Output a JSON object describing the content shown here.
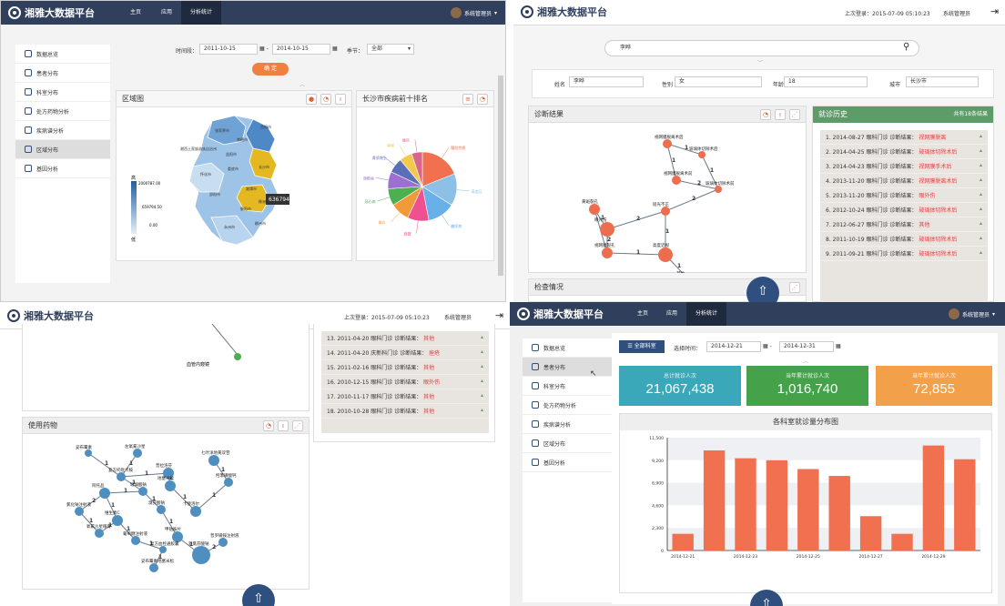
{
  "app": {
    "title": "湘雅大数据平台",
    "admin": "系统管理员",
    "last_login": "上次登录：2015-07-09 05:10:23"
  },
  "nav": {
    "home": "主页",
    "apps": "应用",
    "analytics": "分析统计"
  },
  "sidebar": [
    {
      "label": "数据总览"
    },
    {
      "label": "患者分布"
    },
    {
      "label": "科室分布"
    },
    {
      "label": "处方药物分析"
    },
    {
      "label": "疾病谱分析"
    },
    {
      "label": "区域分布"
    },
    {
      "label": "基因分析"
    }
  ],
  "q1": {
    "period_label": "时间段：",
    "date_from": "2011-10-15",
    "date_to": "2014-10-15",
    "season_label": "季节：",
    "season": "全部",
    "ok": "确 定",
    "map_title": "区域图",
    "pie_title": "长沙市疾病前十排名",
    "legend_high": "高",
    "legend_low": "低",
    "legend_max": "2000787.00",
    "legend_mid": "659794.50",
    "legend_min": "0.00",
    "tooltip": "636794",
    "map_labels": [
      "张家界市",
      "常德市",
      "益阳市",
      "湘西土家族苗族自治州",
      "岳阳市",
      "怀化市",
      "娄底市",
      "长沙市",
      "邵阳市",
      "湘潭市",
      "株洲市",
      "永州市",
      "郴州市",
      "衡阳市"
    ],
    "pie_labels": [
      "腰肌劳损",
      "高血压",
      "糖尿病",
      "感冒",
      "胃炎",
      "冠心病",
      "颈椎病",
      "骨质增生",
      "哮喘",
      "痛风"
    ]
  },
  "q2": {
    "search": "李晔",
    "name_label": "姓名",
    "name": "李晔",
    "gender_label": "性别",
    "gender": "女",
    "age_label": "年龄",
    "age": "18",
    "city_label": "城市",
    "city": "长沙市",
    "diag_title": "诊断结果",
    "hist_title": "就诊历史",
    "hist_count": "共有18条结果",
    "exam_title": "检查情况",
    "history": [
      {
        "n": "1.",
        "date": "2014-08-27",
        "dept": "眼科门诊",
        "lbl": "诊断结果：",
        "res": "视网膜脱离"
      },
      {
        "n": "2.",
        "date": "2014-04-25",
        "dept": "眼科门诊",
        "lbl": "诊断结果：",
        "res": "玻璃体切除术后"
      },
      {
        "n": "3.",
        "date": "2014-04-23",
        "dept": "眼科门诊",
        "lbl": "诊断结果：",
        "res": "视网膜手术后"
      },
      {
        "n": "4.",
        "date": "2013-11-20",
        "dept": "眼科门诊",
        "lbl": "诊断结果：",
        "res": "视网膜脱离术后"
      },
      {
        "n": "5.",
        "date": "2013-11-20",
        "dept": "眼科门诊",
        "lbl": "诊断结果：",
        "res": "眼外伤"
      },
      {
        "n": "6.",
        "date": "2012-10-24",
        "dept": "眼科门诊",
        "lbl": "诊断结果：",
        "res": "玻璃体切除术后"
      },
      {
        "n": "7.",
        "date": "2012-06-27",
        "dept": "眼科门诊",
        "lbl": "诊断结果：",
        "res": "其他"
      },
      {
        "n": "8.",
        "date": "2011-10-19",
        "dept": "眼科门诊",
        "lbl": "诊断结果：",
        "res": "玻璃体切除术后"
      },
      {
        "n": "9.",
        "date": "2011-09-21",
        "dept": "眼科门诊",
        "lbl": "诊断结果：",
        "res": "玻璃体切除术后"
      }
    ],
    "graph_labels": [
      "视网膜脱离术后",
      "玻璃体切除术后",
      "视网膜脱离术前",
      "玻璃体切除术前",
      "屈光不正",
      "眼外伤",
      "黄斑裂孔",
      "视网膜裂孔",
      "高度近视",
      "其他"
    ],
    "graph_weights": [
      "1",
      "1",
      "1",
      "2",
      "2",
      "2",
      "1",
      "2",
      "1",
      "1",
      "1",
      "2"
    ]
  },
  "q3": {
    "node_text": "血管内窥镜",
    "drug_title": "使用药物",
    "history": [
      {
        "n": "13.",
        "date": "2011-04-20",
        "dept": "眼科门诊",
        "lbl": "诊断结果：",
        "res": "其他"
      },
      {
        "n": "14.",
        "date": "2011-04-20",
        "dept": "庆新科门诊",
        "lbl": "诊断结果：",
        "res": "痤疮"
      },
      {
        "n": "15.",
        "date": "2011-02-16",
        "dept": "眼科门诊",
        "lbl": "诊断结果：",
        "res": "其他"
      },
      {
        "n": "16.",
        "date": "2010-12-15",
        "dept": "眼科门诊",
        "lbl": "诊断结果：",
        "res": "眼外伤"
      },
      {
        "n": "17.",
        "date": "2010-11-17",
        "dept": "眼科门诊",
        "lbl": "诊断结果：",
        "res": "其他"
      },
      {
        "n": "18.",
        "date": "2010-10-28",
        "dept": "眼科门诊",
        "lbl": "诊断结果：",
        "res": "其他"
      }
    ],
    "drug_labels": [
      "妥布霉素",
      "左氧氟沙星",
      "复方托吡卡胺",
      "普拉洛芬",
      "玻璃酸钠",
      "地塞米松",
      "阿托品",
      "溴芬酸钠",
      "卡替洛尔",
      "氯化钠注射液",
      "维生素C",
      "甲钴胺片",
      "葡萄糖注射液",
      "复方血栓通胶囊",
      "双氯芬酸钠",
      "氧氟沙星眼膏",
      "妥布霉素地塞米松",
      "普罗碘铵注射液",
      "羟苯磺酸钙",
      "七叶洋地黄双苷"
    ],
    "drug_weights": [
      "1",
      "1",
      "1",
      "1",
      "2",
      "1",
      "1",
      "1",
      "2",
      "1",
      "1",
      "1"
    ]
  },
  "q4": {
    "all_depts": "全部科室",
    "time_label": "选择时间：",
    "date_from": "2014-12-21",
    "date_to": "2014-12-31",
    "stats": [
      {
        "title": "总计就诊人次",
        "value": "21,067,438",
        "color": "#3aa8b8"
      },
      {
        "title": "当年累计就诊人次",
        "value": "1,016,740",
        "color": "#45a24a"
      },
      {
        "title": "当年累计就诊人次",
        "value": "72,855",
        "color": "#f2a04a"
      }
    ]
  },
  "chart_data": {
    "type": "bar",
    "title": "各科室就诊量分布图",
    "categories": [
      "2014-12-21",
      "2014-12-22",
      "2014-12-23",
      "2014-12-24",
      "2014-12-25",
      "2014-12-26",
      "2014-12-27",
      "2014-12-28",
      "2014-12-29",
      "2014-12-30"
    ],
    "tick_labels": [
      "2014-12-21",
      "2014-12-23",
      "2014-12-25",
      "2014-12-27",
      "2014-12-29"
    ],
    "values": [
      1700,
      10200,
      9400,
      9200,
      8300,
      7600,
      3500,
      1700,
      10700,
      9300
    ],
    "yticks": [
      "11,500",
      "9,200",
      "6,900",
      "4,600",
      "2,300",
      "0"
    ],
    "ylim": [
      0,
      11500
    ],
    "color": "#f07050"
  }
}
